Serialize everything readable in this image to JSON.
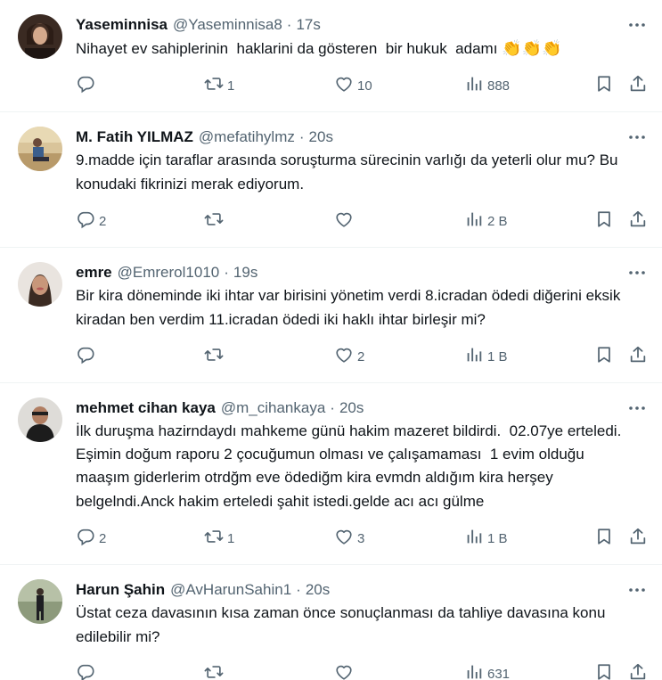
{
  "tweets": [
    {
      "name": "Yaseminnisa",
      "handle": "@Yaseminnisa8",
      "dot": "·",
      "time": "17s",
      "text": "Nihayet ev sahiplerinin  haklarini da gösteren  bir hukuk  adamı ",
      "emoji": "👏👏👏",
      "replies": "",
      "retweets": "1",
      "likes": "10",
      "views": "888"
    },
    {
      "name": "M. Fatih YILMAZ",
      "handle": "@mefatihylmz",
      "dot": "·",
      "time": "20s",
      "text": "9.madde için taraflar arasında soruşturma sürecinin varlığı da yeterli olur mu? Bu konudaki fikrinizi merak ediyorum.",
      "emoji": "",
      "replies": "2",
      "retweets": "",
      "likes": "",
      "views": "2 B"
    },
    {
      "name": "emre",
      "handle": "@Emrerol1010",
      "dot": "·",
      "time": "19s",
      "text": "Bir kira döneminde iki ihtar var birisini yönetim verdi 8.icradan ödedi diğerini eksik kiradan ben verdim 11.icradan ödedi iki haklı ihtar birleşir mi?",
      "emoji": "",
      "replies": "",
      "retweets": "",
      "likes": "2",
      "views": "1 B"
    },
    {
      "name": "mehmet cihan kaya",
      "handle": "@m_cihankaya",
      "dot": "·",
      "time": "20s",
      "text": "İlk duruşma hazirndaydı mahkeme günü hakim mazeret bildirdi.  02.07ye erteledi. Eşimin doğum raporu 2 çocuğumun olması ve çalışamaması  1 evim olduğu maaşım giderlerim otrdğm eve ödediğm kira evmdn aldığım kira herşey belgelndi.Anck hakim erteledi şahit istedi.gelde acı acı gülme",
      "emoji": "",
      "replies": "2",
      "retweets": "1",
      "likes": "3",
      "views": "1 B"
    },
    {
      "name": "Harun Şahin",
      "handle": "@AvHarunSahin1",
      "dot": "·",
      "time": "20s",
      "text": "Üstat ceza davasının kısa zaman önce sonuçlanması da tahliye davasına konu edilebilir mi?",
      "emoji": "",
      "replies": "",
      "retweets": "",
      "likes": "",
      "views": "631"
    }
  ],
  "colors": {
    "text": "#0f1419",
    "muted": "#536471",
    "divider": "#eff3f4"
  },
  "icons": [
    "reply-icon",
    "retweet-icon",
    "like-icon",
    "views-icon",
    "bookmark-icon",
    "share-icon",
    "more-icon"
  ]
}
